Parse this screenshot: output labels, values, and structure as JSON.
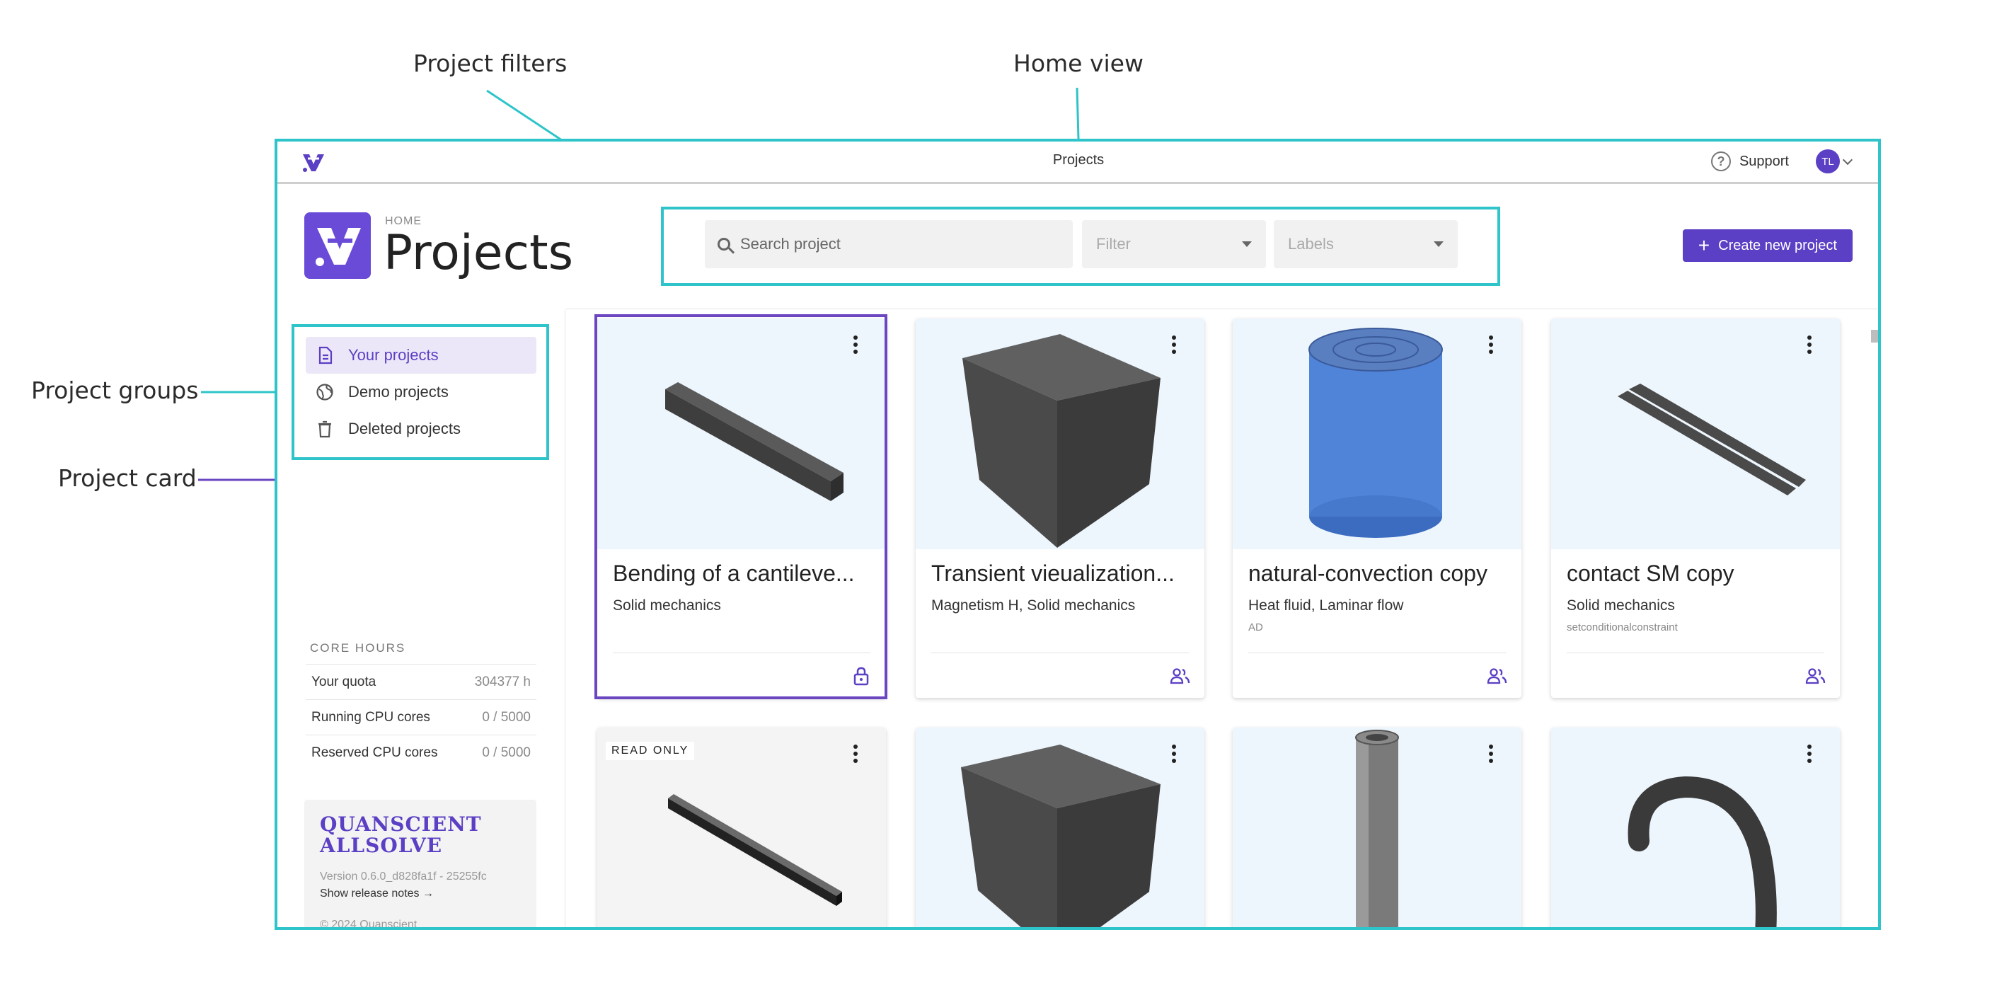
{
  "annotations": {
    "project_filters": "Project filters",
    "home_view": "Home view",
    "project_groups": "Project groups",
    "project_card": "Project card"
  },
  "topbar": {
    "title": "Projects",
    "support_label": "Support",
    "avatar_initials": "TL"
  },
  "header": {
    "breadcrumb": "HOME",
    "title": "Projects"
  },
  "filters": {
    "search_placeholder": "Search project",
    "filter_label": "Filter",
    "labels_label": "Labels"
  },
  "actions": {
    "create_plus": "+",
    "create_label": "Create new project"
  },
  "groups": {
    "items": [
      {
        "label": "Your projects",
        "icon": "document-icon",
        "active": true
      },
      {
        "label": "Demo projects",
        "icon": "globe-icon",
        "active": false
      },
      {
        "label": "Deleted projects",
        "icon": "trash-icon",
        "active": false
      }
    ]
  },
  "core_hours": {
    "title": "CORE HOURS",
    "rows": [
      {
        "label": "Your quota",
        "value": "304377 h"
      },
      {
        "label": "Running CPU cores",
        "value": "0 / 5000"
      },
      {
        "label": "Reserved CPU cores",
        "value": "0 / 5000"
      }
    ]
  },
  "brand": {
    "line1": "QUANSCIENT",
    "line2": "ALLSOLVE",
    "version": "Version 0.6.0_d828fa1f - 25255fc",
    "release_notes": "Show release notes →",
    "copyright": "© 2024 Quanscient"
  },
  "cards": [
    {
      "name": "Bending of a cantileve...",
      "tags": "Solid mechanics",
      "labels": "",
      "footer_icon": "lock-icon",
      "thumbnail": "beam-model"
    },
    {
      "name": "Transient vieualization...",
      "tags": "Magnetism H, Solid mechanics",
      "labels": "",
      "footer_icon": "shared-users-icon",
      "thumbnail": "cube-model"
    },
    {
      "name": "natural-convection copy",
      "tags": "Heat fluid, Laminar flow",
      "labels": "AD",
      "footer_icon": "shared-users-icon",
      "thumbnail": "cylinder-model"
    },
    {
      "name": "contact SM copy",
      "tags": "Solid mechanics",
      "labels": "setconditionalconstraint",
      "footer_icon": "shared-users-icon",
      "thumbnail": "strips-model"
    },
    {
      "badge": "READ ONLY",
      "thumbnail": "thin-beam-model"
    },
    {
      "thumbnail": "cube-model"
    },
    {
      "thumbnail": "tube-model"
    },
    {
      "thumbnail": "hook-model"
    }
  ],
  "colors": {
    "accent": "#5b3fc4",
    "annotation": "#2ec4c9",
    "card_annotation": "#6b46c1",
    "thumb_bg": "#eef6fd"
  }
}
